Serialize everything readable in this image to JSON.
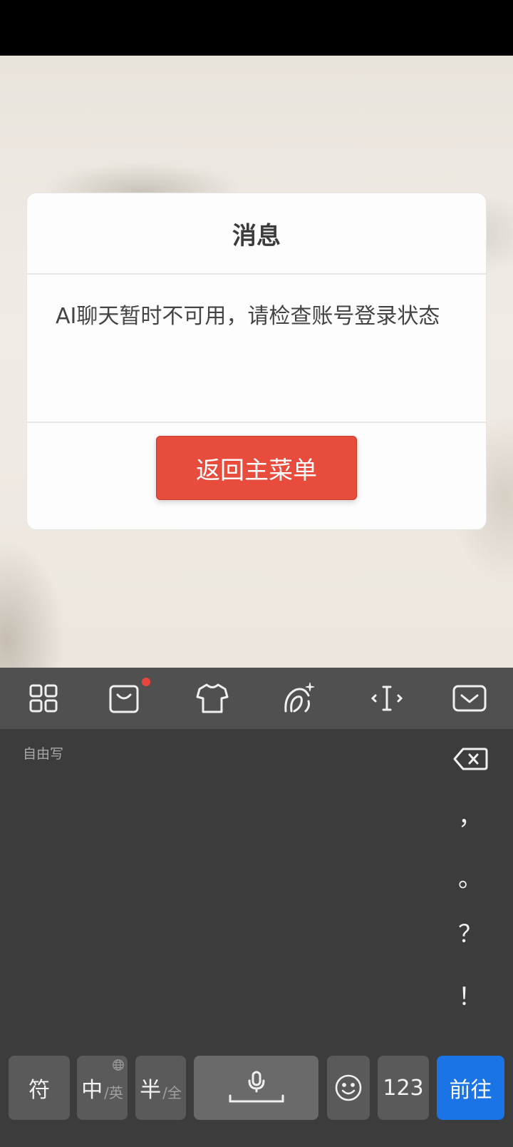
{
  "dialog": {
    "title": "消息",
    "message": "AI聊天暂时不可用，请检查账号登录状态",
    "return_button": "返回主菜单"
  },
  "keyboard": {
    "toolbar_icons": [
      "grid-icon",
      "store-bag-icon",
      "tshirt-skin-icon",
      "ai-write-icon",
      "cursor-move-icon",
      "hide-keyboard-icon"
    ],
    "handwriting_hint": "自由写",
    "side_keys": {
      "comma": "，",
      "period": "。",
      "question": "？",
      "exclaim": "！"
    },
    "bottom_keys": {
      "symbols": "符",
      "cn_label": "中",
      "cn_sub": "/英",
      "half_label": "半",
      "half_sub": "/全",
      "numbers": "123",
      "go": "前往"
    },
    "colors": {
      "toolbar_bg": "#505050",
      "keyboard_bg": "#3c3c3c",
      "key_bg": "#5a5a5a",
      "go_key_bg": "#1a74e6",
      "return_button_bg": "#e84c3d",
      "badge": "#e8453c"
    }
  }
}
